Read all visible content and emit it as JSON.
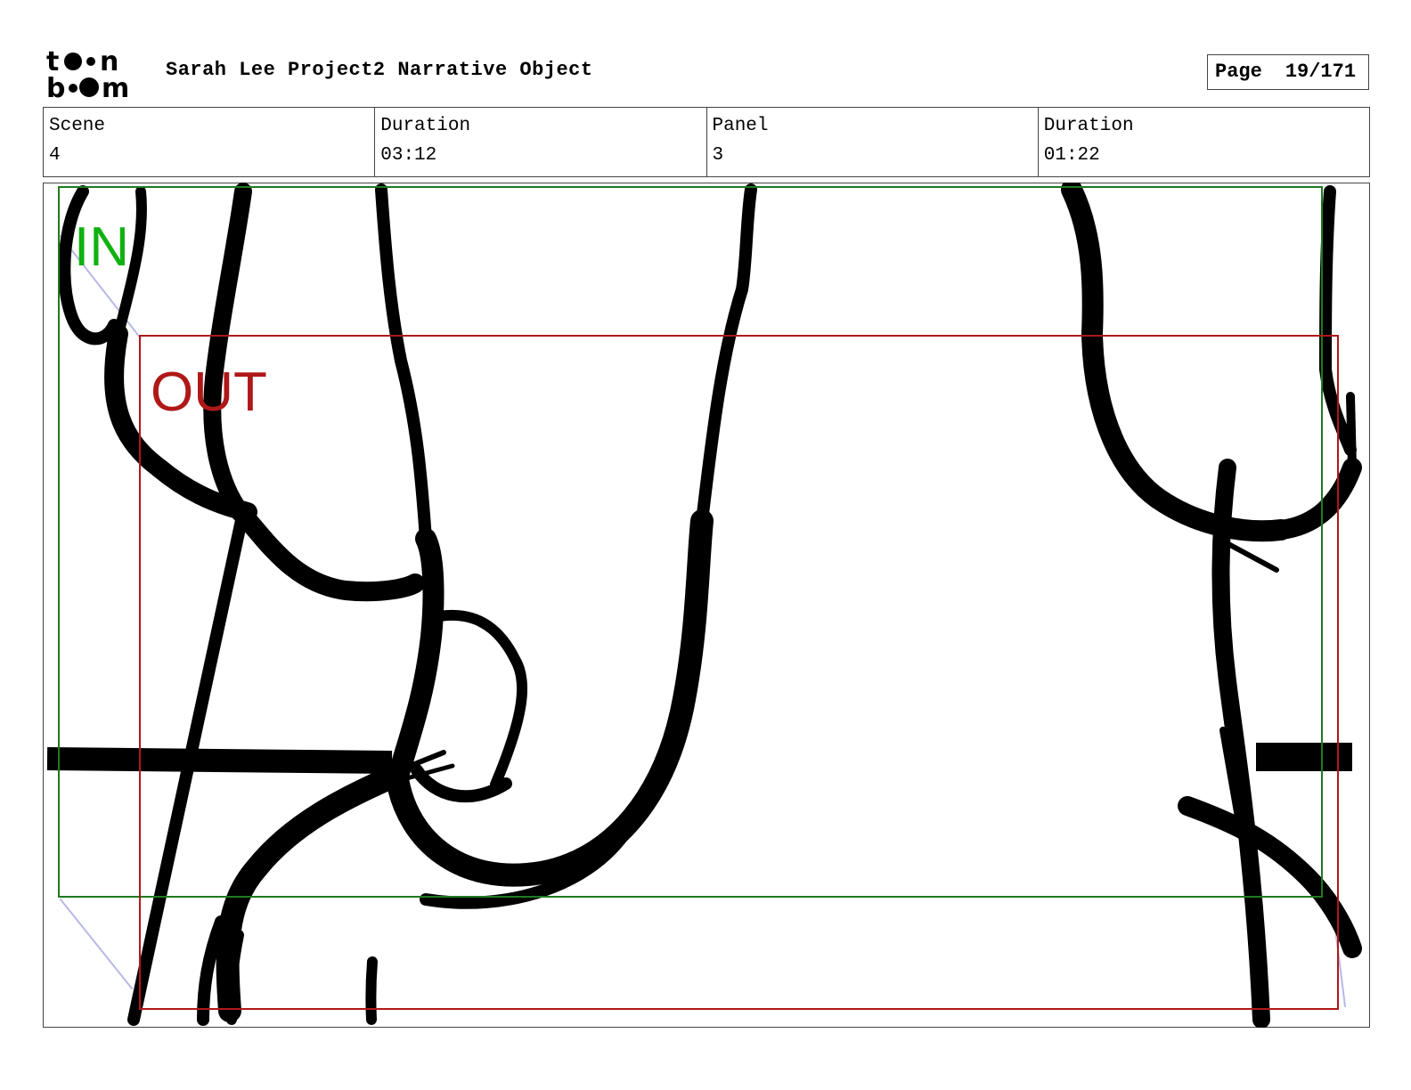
{
  "header": {
    "project_title": "Sarah Lee Project2 Narrative Object",
    "page_label": "Page",
    "page_value": "19/171",
    "logo": {
      "top_text": "toon",
      "bottom_text": "boom"
    }
  },
  "info": {
    "scene_label": "Scene",
    "scene_value": "4",
    "scene_duration_label": "Duration",
    "scene_duration_value": "03:12",
    "panel_label": "Panel",
    "panel_value": "3",
    "panel_duration_label": "Duration",
    "panel_duration_value": "01:22"
  },
  "panel": {
    "in_label": "IN",
    "out_label": "OUT",
    "colors": {
      "in_frame": "#1f7a1f",
      "in_text": "#10b010",
      "out_frame": "#b01818",
      "out_text": "#b01818",
      "ink": "#000000"
    }
  }
}
